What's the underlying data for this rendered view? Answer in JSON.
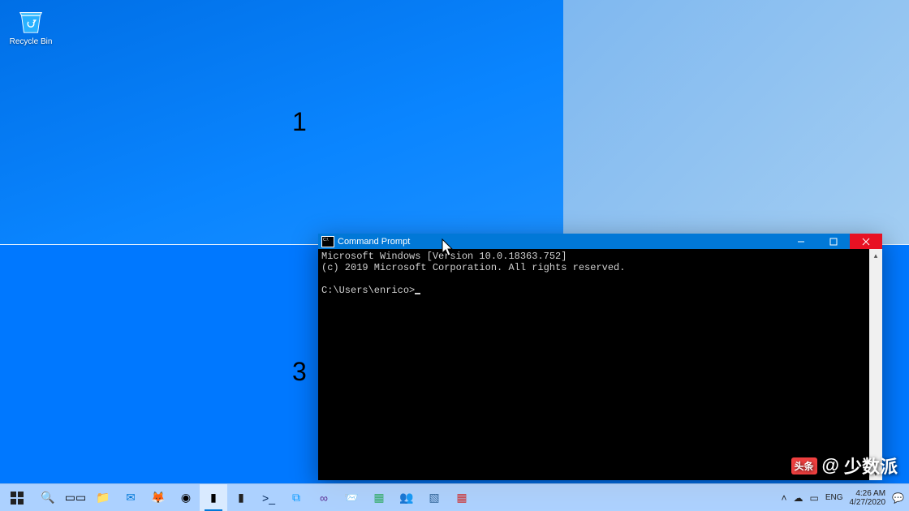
{
  "desktop": {
    "recycle_bin_label": "Recycle Bin",
    "zone_labels": {
      "one": "1",
      "three": "3"
    }
  },
  "cmd": {
    "title": "Command Prompt",
    "line1": "Microsoft Windows [Version 10.0.18363.752]",
    "line2": "(c) 2019 Microsoft Corporation. All rights reserved.",
    "prompt": "C:\\Users\\enrico>"
  },
  "taskbar": {
    "start": "⊞",
    "icons": [
      {
        "name": "search-icon",
        "glyph": "🔍"
      },
      {
        "name": "task-view-icon",
        "glyph": "▭▭"
      },
      {
        "name": "file-explorer-icon",
        "glyph": "📁"
      },
      {
        "name": "mail-icon",
        "glyph": "✉",
        "color": "#0178d7"
      },
      {
        "name": "firefox-icon",
        "glyph": "🦊"
      },
      {
        "name": "chrome-icon",
        "glyph": "◉"
      },
      {
        "name": "cmd-icon",
        "glyph": "▮",
        "active": true,
        "color": "#000"
      },
      {
        "name": "terminal-icon",
        "glyph": "▮",
        "color": "#222"
      },
      {
        "name": "powershell-icon",
        "glyph": ">_",
        "color": "#012456"
      },
      {
        "name": "vscode-icon",
        "glyph": "⧉",
        "color": "#0098ff"
      },
      {
        "name": "visual-studio-icon",
        "glyph": "∞",
        "color": "#5c2d91"
      },
      {
        "name": "outlook-icon",
        "glyph": "📨",
        "color": "#0178d7"
      },
      {
        "name": "app-icon",
        "glyph": "▦",
        "color": "#3a6"
      },
      {
        "name": "teams-icon",
        "glyph": "👥",
        "color": "#4b53bc"
      },
      {
        "name": "app2-icon",
        "glyph": "▧",
        "color": "#369"
      },
      {
        "name": "powertoys-icon",
        "glyph": "▦",
        "color": "#c33"
      }
    ]
  },
  "tray": {
    "chevron": "˄",
    "onedrive": "☁",
    "battery": "▭",
    "lang": "ENG",
    "time": "4:26 AM",
    "date": "4/27/2020",
    "notif": "💬"
  },
  "watermark": {
    "head": "头条",
    "at": "@",
    "site": "少数派"
  }
}
